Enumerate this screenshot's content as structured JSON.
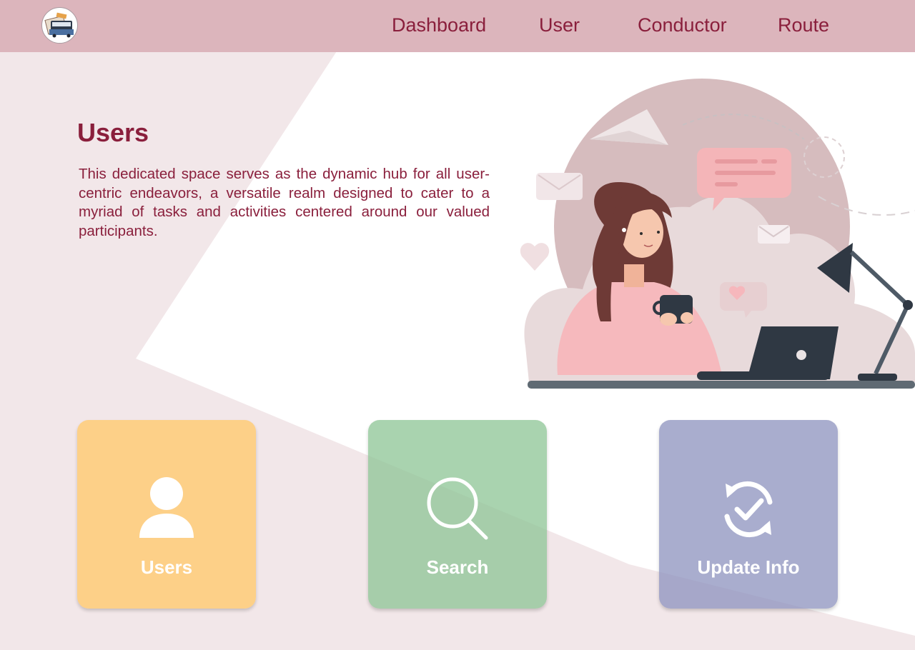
{
  "nav": {
    "items": [
      {
        "label": "Dashboard"
      },
      {
        "label": "User"
      },
      {
        "label": "Conductor"
      },
      {
        "label": "Route"
      }
    ]
  },
  "hero": {
    "title": "Users",
    "description": "This dedicated space serves as the dynamic hub for all user-centric endeavors, a versatile realm designed to cater to a myriad of tasks and activities centered around our valued participants."
  },
  "cards": [
    {
      "label": "Users",
      "icon": "user-icon",
      "color": "#fecd7d"
    },
    {
      "label": "Search",
      "icon": "search-icon",
      "color": "#a6cfab"
    },
    {
      "label": "Update Info",
      "icon": "refresh-check-icon",
      "color": "#a8abca"
    }
  ],
  "colors": {
    "navbar": "#dcb5bc",
    "accent": "#8a1f3c",
    "background_shape": "#f2e7e9"
  }
}
